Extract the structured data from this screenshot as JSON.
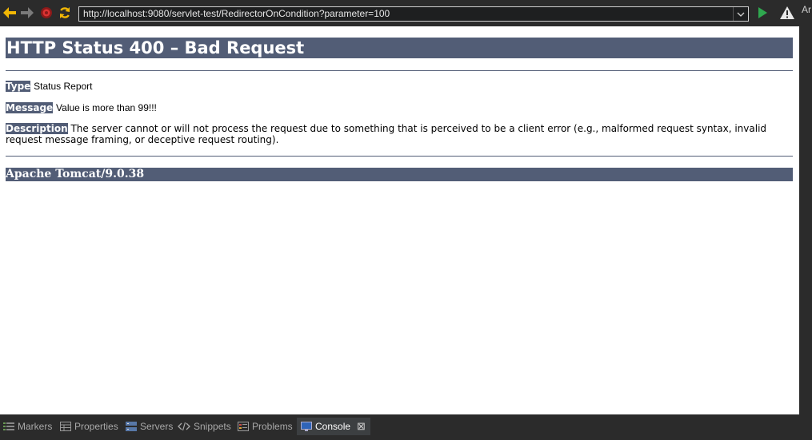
{
  "browser": {
    "url": "http://localhost:9080/servlet-test/RedirectorOnCondition?parameter=100",
    "right_edge_text": "Ar",
    "icons": [
      "back-arrow-icon",
      "forward-arrow-icon",
      "stop-icon",
      "refresh-icon",
      "dropdown-chevron-icon",
      "go-run-icon",
      "warning-icon"
    ]
  },
  "page": {
    "title": "HTTP Status 400 – Bad Request",
    "type_label": "Type",
    "type_value": "Status Report",
    "message_label": "Message",
    "message_value": "Value is more than 99!!!",
    "description_label": "Description",
    "description_value": "The server cannot or will not process the request due to something that is perceived to be a client error (e.g., malformed request syntax, invalid request message framing, or deceptive request routing).",
    "server_footer": "Apache Tomcat/9.0.38"
  },
  "views": {
    "tabs": [
      {
        "label": "Markers",
        "icon": "markers-icon"
      },
      {
        "label": "Properties",
        "icon": "properties-icon"
      },
      {
        "label": "Servers",
        "icon": "servers-icon"
      },
      {
        "label": "Snippets",
        "icon": "snippets-icon"
      },
      {
        "label": "Problems",
        "icon": "problems-icon"
      },
      {
        "label": "Console",
        "icon": "console-icon",
        "active": true
      }
    ],
    "close_glyph": "⊠"
  },
  "colors": {
    "tomcat_header": "#525d76",
    "toolbar_bg": "#2b2b2b"
  }
}
